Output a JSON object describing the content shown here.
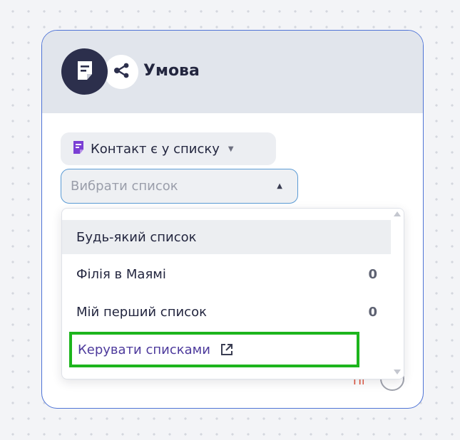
{
  "node": {
    "title": "Умова",
    "primary_icon": "note-icon",
    "secondary_icon": "share-icon"
  },
  "condition": {
    "label": "Контакт є у списку",
    "icon": "list-icon",
    "icon_color": "#7a3fd4"
  },
  "list_select": {
    "placeholder": "Вибрати список",
    "border_color": "#5b9bd5"
  },
  "status_hint": "Пі",
  "dropdown": {
    "items": [
      {
        "label": "Будь-який список",
        "count": ""
      },
      {
        "label": "Філія в Маямі",
        "count": "0"
      },
      {
        "label": "Мій перший список",
        "count": "0"
      }
    ],
    "manage": {
      "label": "Керувати списками",
      "icon": "external-link-icon",
      "highlight_color": "#1db51d"
    }
  },
  "colors": {
    "card_border": "#4f74d6",
    "header_bg": "#e1e5ec",
    "badge_dark": "#2c2f4c",
    "link_text": "#4d3a9c"
  }
}
